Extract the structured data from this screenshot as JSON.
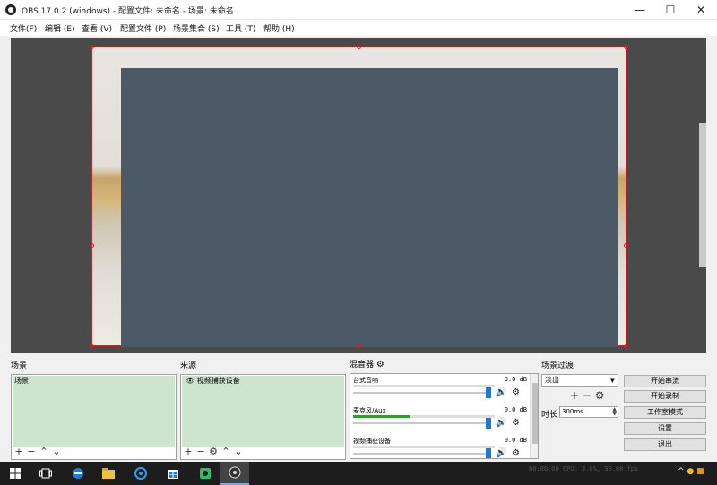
{
  "window": {
    "title": "OBS 17.0.2 (windows) - 配置文件: 未命名 - 场景: 未命名",
    "minimize": "—",
    "maximize": "☐",
    "close": "✕"
  },
  "menu": [
    "文件(F)",
    "编辑 (E)",
    "查看 (V)",
    "配置文件 (P)",
    "场景集合 (S)",
    "工具 (T)",
    "帮助 (H)"
  ],
  "scenes": {
    "title": "场景",
    "items": [
      "场景"
    ]
  },
  "sources": {
    "title": "来源",
    "items": [
      "视频捕获设备"
    ]
  },
  "mixer": {
    "title": "混音器",
    "channels": [
      {
        "name": "台式音响",
        "db": "0.0 dB",
        "level": 0.0
      },
      {
        "name": "麦克风/Aux",
        "db": "0.0 dB",
        "level": 0.4
      },
      {
        "name": "视频捕获设备",
        "db": "0.0 dB",
        "level": 0.0
      }
    ]
  },
  "transitions": {
    "title": "场景过渡",
    "selected": "淡出",
    "duration_label": "时长",
    "duration_value": "300ms"
  },
  "controls": [
    "开始串流",
    "开始录制",
    "工作室模式",
    "设置",
    "退出"
  ],
  "status": "00:00:00  CPU: 3.0%, 30.00 fps",
  "colors": {
    "selection_green": "#cde5cd",
    "preview_bg": "#4a4a4a",
    "capture_fill": "#4b5a66",
    "volume_handle": "#1a7ad9",
    "source_outline": "#d02020"
  }
}
